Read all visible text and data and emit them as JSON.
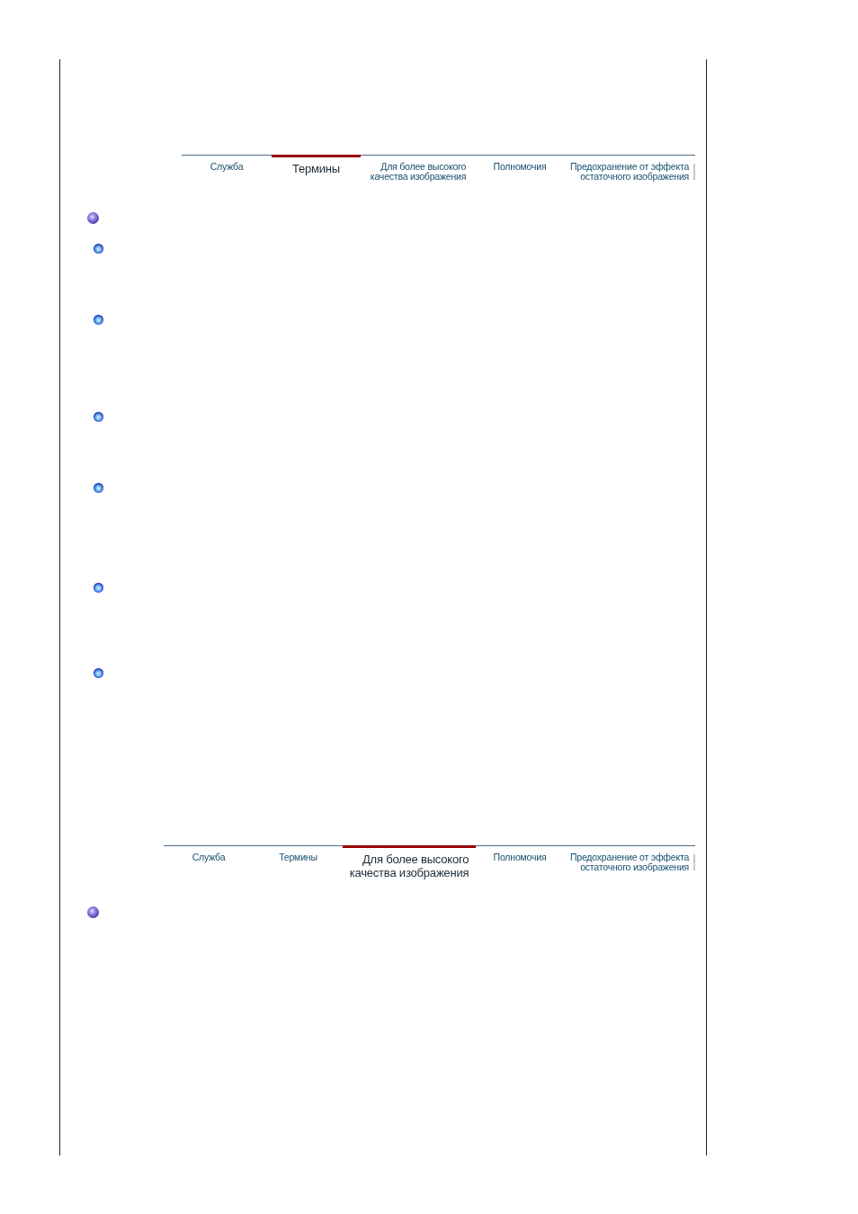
{
  "sections": [
    {
      "tabs": [
        {
          "label": "Служба",
          "selected": false
        },
        {
          "label": "Термины",
          "selected": true
        },
        {
          "label": "Для более высокого\nкачества изображения",
          "selected": false
        },
        {
          "label": "Полномочия",
          "selected": false
        },
        {
          "label": "Предохранение от эффекта\nостаточного изображения",
          "selected": false
        }
      ],
      "bullets": [
        {
          "kind": "main"
        },
        {
          "kind": "sub"
        },
        {
          "kind": "sub"
        },
        {
          "kind": "sub"
        },
        {
          "kind": "sub"
        },
        {
          "kind": "sub"
        },
        {
          "kind": "sub"
        }
      ]
    },
    {
      "tabs": [
        {
          "label": "Служба",
          "selected": false
        },
        {
          "label": "Термины",
          "selected": false
        },
        {
          "label": "Для более высокого\nкачества изображения",
          "selected": true
        },
        {
          "label": "Полномочия",
          "selected": false
        },
        {
          "label": "Предохранение от эффекта\nостаточного изображения",
          "selected": false
        }
      ],
      "bullets": [
        {
          "kind": "main"
        }
      ]
    }
  ]
}
